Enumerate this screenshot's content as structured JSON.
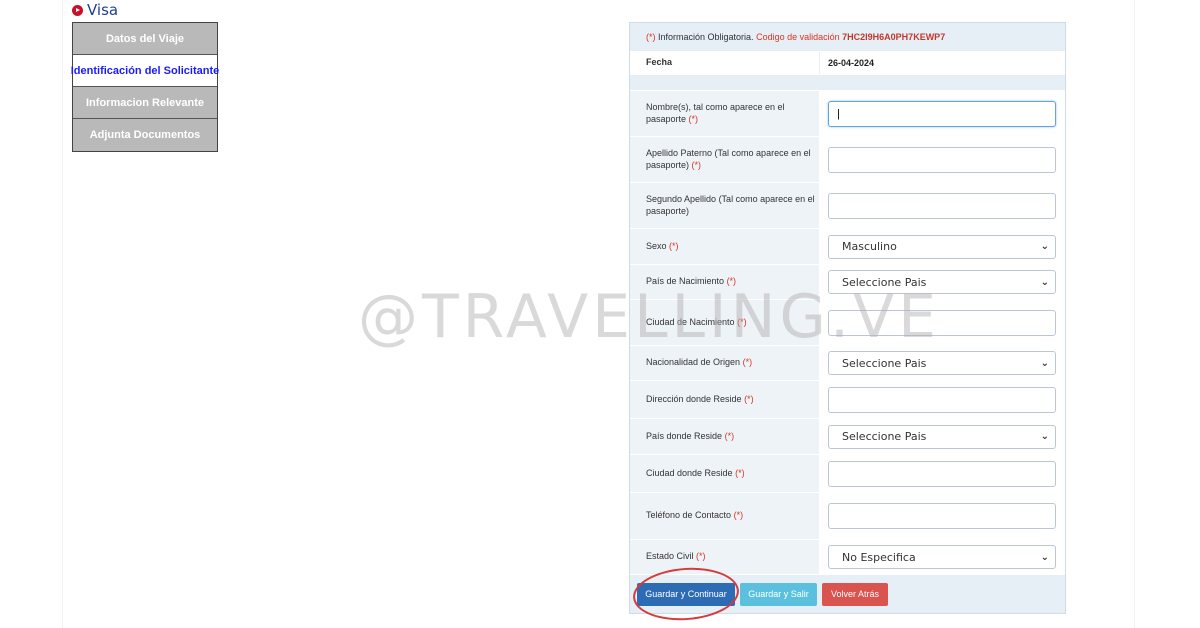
{
  "header": {
    "title": "Visa",
    "icon": "play-circle-icon"
  },
  "sidebar": {
    "items": [
      {
        "label": "Datos del Viaje",
        "active": false
      },
      {
        "label": "Identificación del Solicitante",
        "active": true
      },
      {
        "label": "Informacion Relevante",
        "active": false
      },
      {
        "label": "Adjunta Documentos",
        "active": false
      }
    ]
  },
  "form": {
    "info": {
      "required_marker": "(*)",
      "required_text": "Información Obligatoria.",
      "validation_label": "Codigo de validación",
      "validation_code": "7HC2I9H6A0PH7KEWP7"
    },
    "fecha": {
      "label": "Fecha",
      "value": "26-04-2024"
    },
    "req_marker": "(*)",
    "fields": [
      {
        "label": "Nombre(s), tal como aparece en el pasaporte",
        "value": "|",
        "type": "text"
      },
      {
        "label": "Apellido Paterno (Tal como aparece en el pasaporte)",
        "value": "",
        "type": "text"
      },
      {
        "label": "Segundo Apellido (Tal como aparece en el pasaporte)",
        "value": "",
        "type": "text"
      },
      {
        "label": "Sexo",
        "value": "Masculino",
        "type": "select"
      },
      {
        "label": "País de Nacimiento",
        "value": "Seleccione Pais",
        "type": "select"
      },
      {
        "label": "Ciudad de Nacimiento",
        "value": "",
        "type": "text"
      },
      {
        "label": "Nacionalidad de Origen",
        "value": "Seleccione Pais",
        "type": "select"
      },
      {
        "label": "Dirección donde Reside",
        "value": "",
        "type": "text"
      },
      {
        "label": "País donde Reside",
        "value": "Seleccione Pais",
        "type": "select"
      },
      {
        "label": "Ciudad donde Reside",
        "value": "",
        "type": "text"
      },
      {
        "label": "Teléfono de Contacto",
        "value": "",
        "type": "text"
      },
      {
        "label": "Estado Civil",
        "value": "No Especifica",
        "type": "select"
      }
    ],
    "buttons": {
      "save_continue": "Guardar y Continuar",
      "save_exit": "Guardar y Salir",
      "back": "Volver Atrás"
    }
  },
  "watermark": "@TRAVELLING.VE",
  "colors": {
    "primary": "#2d6bb5",
    "info": "#5bc0de",
    "danger": "#d9534f",
    "required": "#d9351e",
    "active_menu_text": "#1a1aff",
    "annotation_circle": "#d63a3a"
  }
}
